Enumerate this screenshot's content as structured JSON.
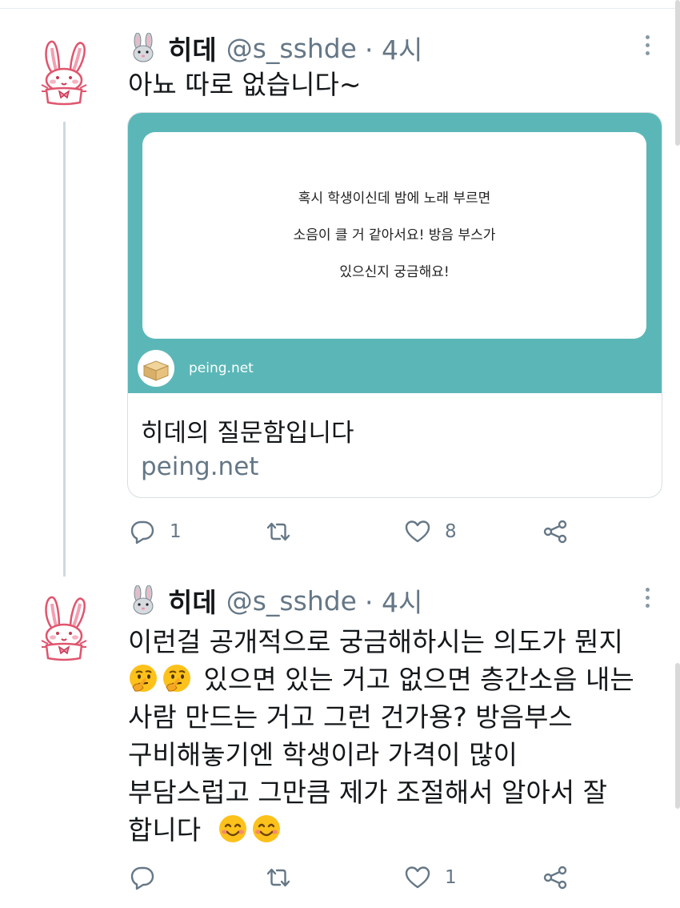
{
  "colors": {
    "card_bg": "#5bb7b7",
    "text": "#14171a",
    "muted": "#657786"
  },
  "tweets": [
    {
      "name": "히데",
      "handle": "@s_sshde",
      "time": "· 4시",
      "lines": [
        "아뇨 따로 없습니다~"
      ],
      "card": {
        "question_lines": [
          "혹시 학생이신데 밤에 노래 부르면",
          "소음이 클 거 같아서요! 방음 부스가",
          "있으신지 궁금해요!"
        ],
        "site_label": "peing.net",
        "title": "히데의 질문함입니다",
        "domain": "peing.net"
      },
      "actions": {
        "reply_count": "1",
        "retweet_count": "",
        "like_count": "8"
      }
    },
    {
      "name": "히데",
      "handle": "@s_sshde",
      "time": "· 4시",
      "lines": [
        "이런걸 공개적으로 궁금해하시는 의도가 뭔지",
        "있으면 있는 거고 없으면 층간소음 내는",
        "사람 만드는 거고 그런 건가용? 방음부스",
        "구비해놓기엔 학생이라 가격이 많이",
        "부담스럽고 그만큼 제가 조절해서 알아서 잘",
        "합니다"
      ],
      "emojis": [
        "thinking-face-icon",
        "thinking-face-icon",
        "smiling-face-icon",
        "smiling-face-icon"
      ],
      "actions": {
        "reply_count": "",
        "retweet_count": "",
        "like_count": "1"
      }
    }
  ]
}
